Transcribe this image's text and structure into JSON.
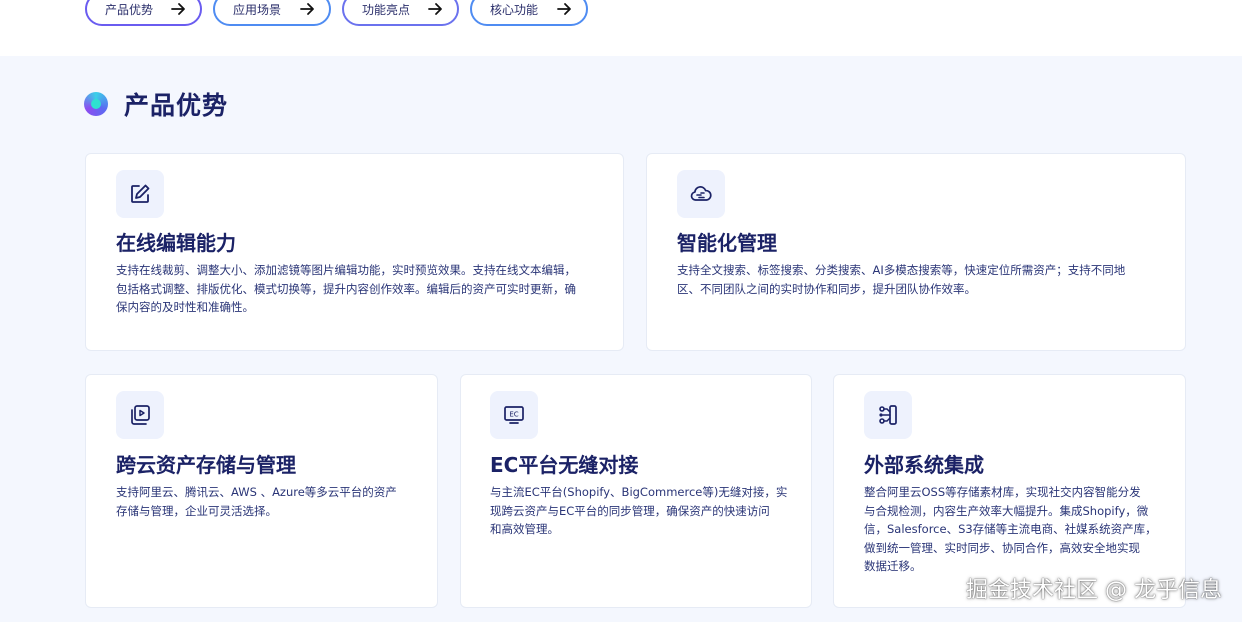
{
  "nav": {
    "pills": [
      {
        "label": "产品优势"
      },
      {
        "label": "应用场景"
      },
      {
        "label": "功能亮点"
      },
      {
        "label": "核心功能"
      }
    ]
  },
  "section": {
    "title": "产品优势"
  },
  "cards": [
    {
      "icon": "edit-icon",
      "title": "在线编辑能力",
      "desc_lines": [
        "支持在线裁剪、调整大小、添加滤镜等图片编辑功能，实时预览效果。支持在线文本编辑，",
        "包括格式调整、排版优化、模式切换等，提升内容创作效率。编辑后的资产可实时更新，确",
        "保内容的及时性和准确性。"
      ]
    },
    {
      "icon": "cloud-brain-icon",
      "title": "智能化管理",
      "desc_lines": [
        "支持全文搜索、标签搜索、分类搜索、AI多模态搜索等，快速定位所需资产；支持不同地",
        "区、不同团队之间的实时协作和同步，提升团队协作效率。"
      ]
    },
    {
      "icon": "media-library-icon",
      "title": "跨云资产存储与管理",
      "desc_lines": [
        "支持阿里云、腾讯云、AWS 、Azure等多云平台的资产",
        "存储与管理，企业可灵活选择。"
      ]
    },
    {
      "icon": "ec-monitor-icon",
      "title": "EC平台无缝对接",
      "desc_lines": [
        "与主流EC平台(Shopify、BigCommerce等)无缝对接，实",
        "现跨云资产与EC平台的同步管理，确保资产的快速访问",
        "和高效管理。"
      ]
    },
    {
      "icon": "integration-icon",
      "title": "外部系统集成",
      "desc_lines": [
        "整合阿里云OSS等存储素材库，实现社交内容智能分发",
        "与合规检测，内容生产效率大幅提升。集成Shopify，微",
        "信，Salesforce、S3存储等主流电商、社媒系统资产库，",
        "做到统一管理、实时同步、协同合作，高效安全地实现",
        "数据迁移。"
      ]
    }
  ],
  "watermark": "掘金技术社区 @ 龙乎信息",
  "colors": {
    "accent": "#4d6bff",
    "title": "#1b2266",
    "section_bg": "#f4f7fe"
  }
}
